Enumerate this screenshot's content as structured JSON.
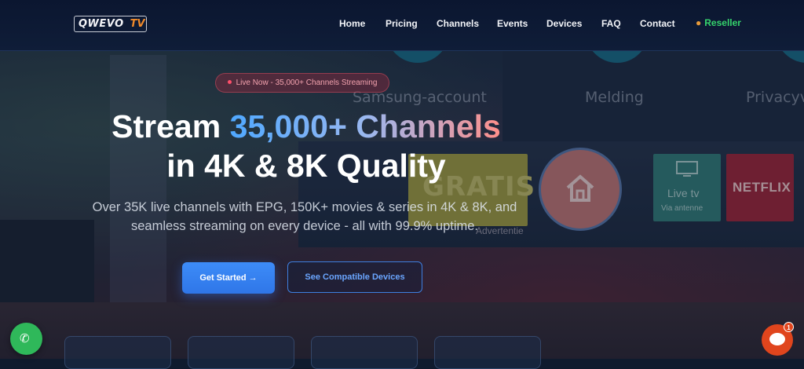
{
  "header": {
    "logo_brand": "QWEVO",
    "logo_tv": "TV",
    "nav": [
      "Home",
      "Pricing",
      "Channels",
      "Events",
      "Devices",
      "FAQ",
      "Contact"
    ],
    "reseller_label": "Reseller"
  },
  "background": {
    "tv_row": [
      "Samsung-account",
      "Melding",
      "Privacyv"
    ],
    "tile_gratis": "GRATIS",
    "tile_livetv_title": "Live tv",
    "tile_livetv_sub": "Via antenne",
    "tile_netflix": "NETFLIX",
    "advert": "Advertentie"
  },
  "hero": {
    "badge": "Live Now - 35,000+ Channels Streaming",
    "title_line1_prefix": "Stream ",
    "title_line1_highlight": "35,000+ Channels",
    "title_line2": "in 4K & 8K Quality",
    "subtitle_line1": "Over 35K live channels with EPG, 150K+ movies & series in 4K & 8K, and",
    "subtitle_line2": "seamless streaming on every device - all with 99.9% uptime.",
    "cta_primary": "Get Started →",
    "cta_secondary": "See Compatible Devices"
  },
  "widgets": {
    "chat_badge_count": "1"
  },
  "colors": {
    "accent_blue": "#3d8cf8",
    "reseller_green": "#35d46c",
    "logo_orange": "#f08a2a",
    "badge_red": "#ff4f6b"
  }
}
